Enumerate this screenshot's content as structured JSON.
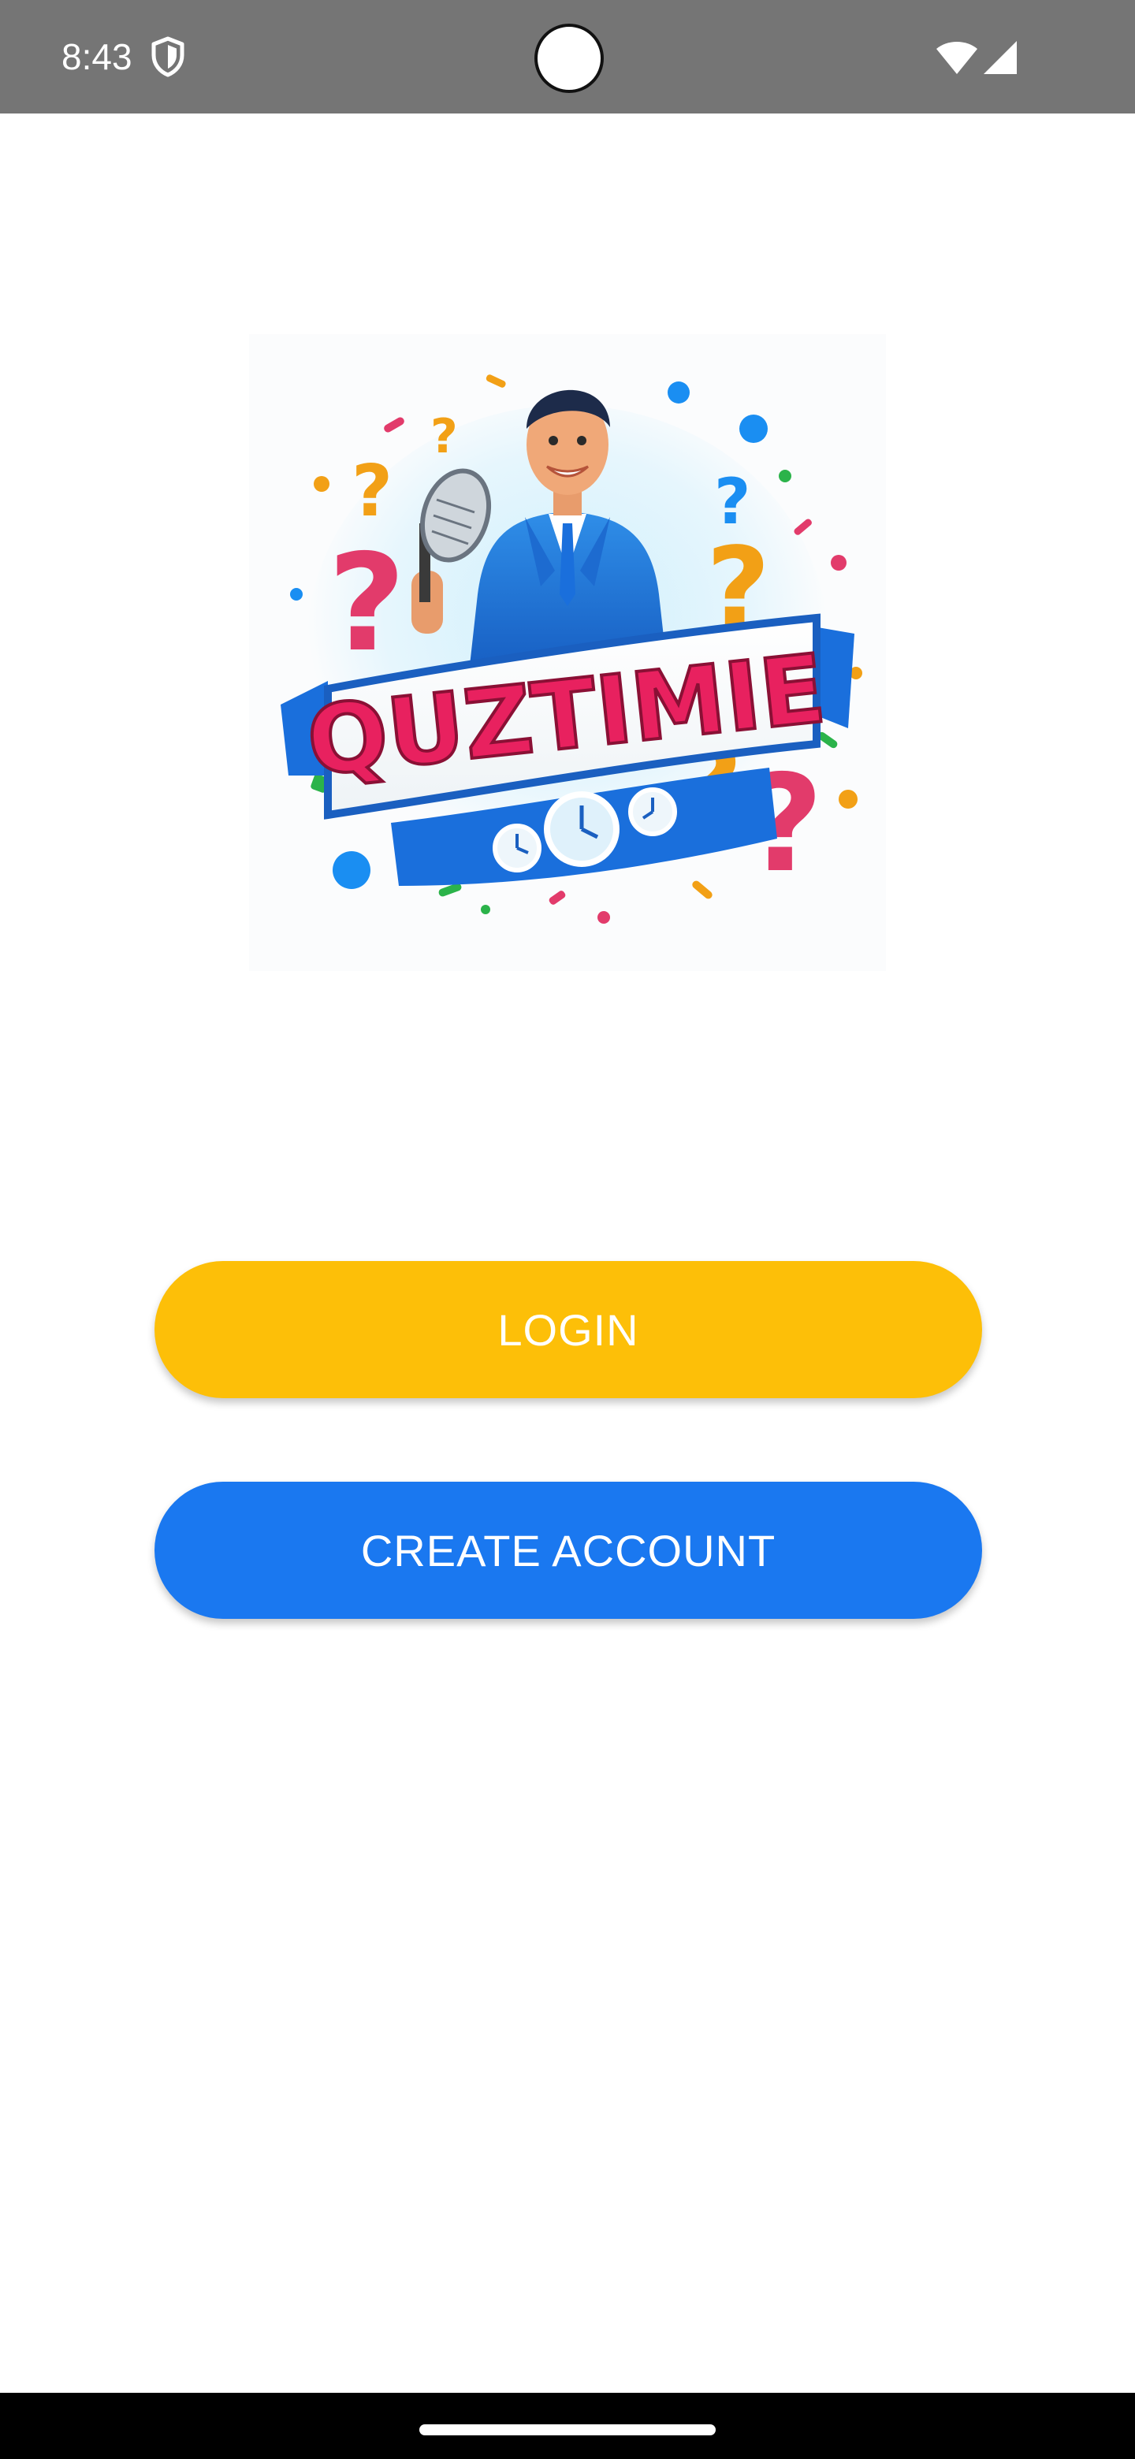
{
  "status_bar": {
    "time": "8:43",
    "icons": [
      "shield-icon",
      "wifi-icon",
      "cellular-signal-icon"
    ],
    "background": "#757575"
  },
  "logo": {
    "text": "QUZTIMIE",
    "description_icon": "quiz-host-logo"
  },
  "buttons": {
    "login_label": "LOGIN",
    "create_account_label": "CREATE ACCOUNT"
  },
  "colors": {
    "login": "#FDBF08",
    "create_account": "#1A78F0",
    "nav_bar": "#000000"
  }
}
